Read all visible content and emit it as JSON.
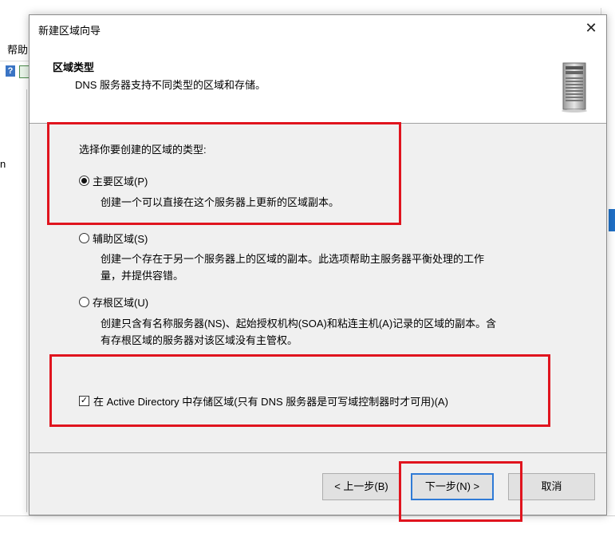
{
  "background": {
    "menu_help": "帮助",
    "toolbar_help_icon": "?",
    "tree_items": [
      "n"
    ]
  },
  "wizard": {
    "title": "新建区域向导",
    "close_icon": "✕",
    "header": {
      "title": "区域类型",
      "subtitle": "DNS 服务器支持不同类型的区域和存储。",
      "icon": "server-icon"
    },
    "prompt": "选择你要创建的区域的类型:",
    "zone_types": [
      {
        "label": "主要区域(P)",
        "selected": true,
        "description": "创建一个可以直接在这个服务器上更新的区域副本。"
      },
      {
        "label": "辅助区域(S)",
        "selected": false,
        "description_lines": [
          "创建一个存在于另一个服务器上的区域的副本。此选项帮助主服务器平衡处理的工作",
          "量，并提供容错。"
        ]
      },
      {
        "label": "存根区域(U)",
        "selected": false,
        "description_lines": [
          "创建只含有名称服务器(NS)、起始授权机构(SOA)和粘连主机(A)记录的区域的副本。含",
          "有存根区域的服务器对该区域没有主管权。"
        ]
      }
    ],
    "store_in_ad": {
      "label": "在 Active Directory 中存储区域(只有 DNS 服务器是可写域控制器时才可用)(A)",
      "checked": true,
      "check_glyph": "✓"
    },
    "buttons": {
      "back": "< 上一步(B)",
      "next": "下一步(N) >",
      "cancel": "取消"
    },
    "highlight_color": "#e0141e"
  }
}
